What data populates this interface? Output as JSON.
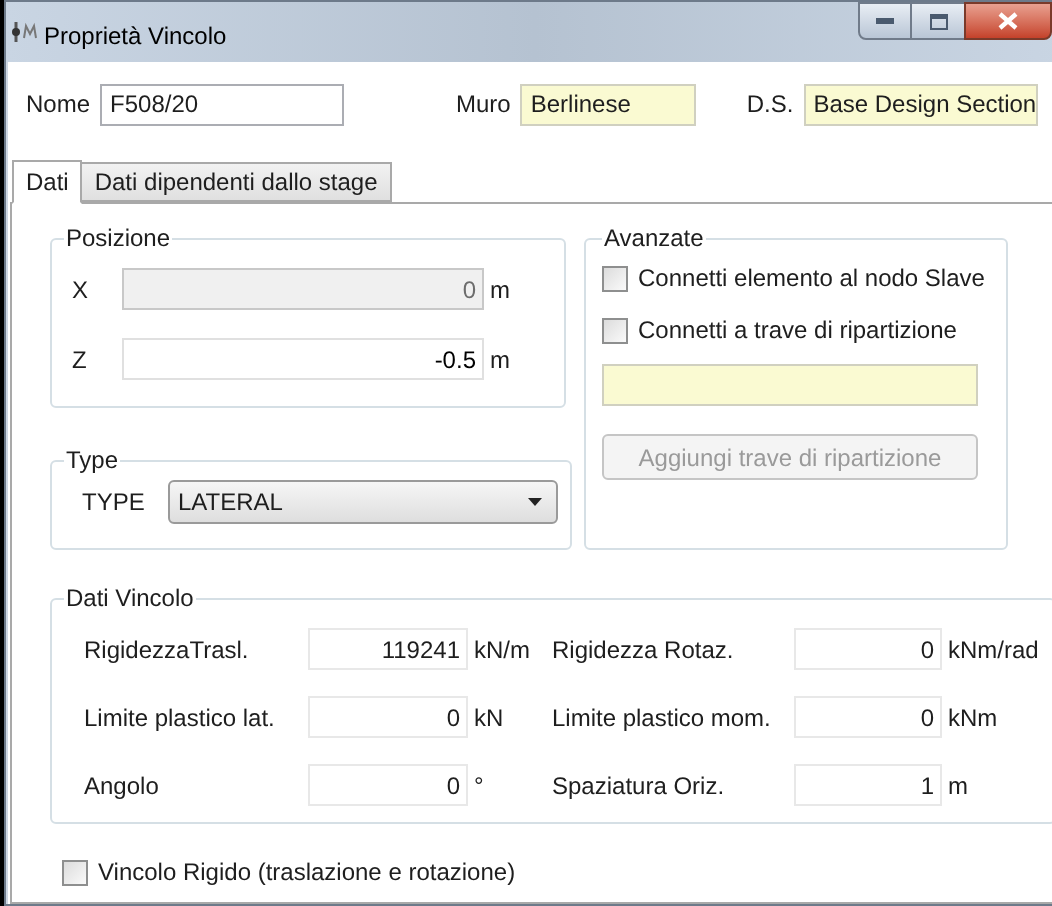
{
  "window": {
    "title": "Proprietà Vincolo"
  },
  "header_fields": [
    {
      "label": "Nome",
      "value": "F508/20",
      "readonly": false
    },
    {
      "label": "Muro",
      "value": "Berlinese",
      "readonly": true
    },
    {
      "label": "D.S.",
      "value": "Base Design Section",
      "readonly": true
    }
  ],
  "tabs": [
    {
      "label": "Dati",
      "selected": true
    },
    {
      "label": "Dati dipendenti dallo stage",
      "selected": false
    }
  ],
  "posizione": {
    "title": "Posizione",
    "fields": [
      {
        "label": "X",
        "value": "0",
        "unit": "m",
        "disabled": true
      },
      {
        "label": "Z",
        "value": "-0.5",
        "unit": "m",
        "disabled": false
      }
    ]
  },
  "type": {
    "title": "Type",
    "label": "TYPE",
    "value": "LATERAL"
  },
  "avanzate": {
    "title": "Avanzate",
    "checkboxes": [
      {
        "label": "Connetti elemento al nodo Slave",
        "checked": false
      },
      {
        "label": "Connetti a trave di ripartizione",
        "checked": false
      }
    ],
    "trave_field": {
      "readonly": true
    },
    "button": {
      "label": "Aggiungi trave di ripartizione",
      "disabled": true
    }
  },
  "dati_vincolo": {
    "title": "Dati Vincolo",
    "rows": [
      {
        "left": {
          "label": "RigidezzaTrasl.",
          "value": "119241",
          "unit": "kN/m"
        },
        "right": {
          "label": "Rigidezza Rotaz.",
          "value": "0",
          "unit": "kNm/rad"
        }
      },
      {
        "left": {
          "label": "Limite plastico lat.",
          "value": "0",
          "unit": "kN"
        },
        "right": {
          "label": "Limite plastico mom.",
          "value": "0",
          "unit": "kNm"
        }
      },
      {
        "left": {
          "label": "Angolo",
          "value": "0",
          "unit": "°"
        },
        "right": {
          "label": "Spaziatura Oriz.",
          "value": "1",
          "unit": "m"
        }
      }
    ]
  },
  "rigid_checkbox": {
    "label": "Vincolo Rigido (traslazione e rotazione)",
    "checked": false
  }
}
